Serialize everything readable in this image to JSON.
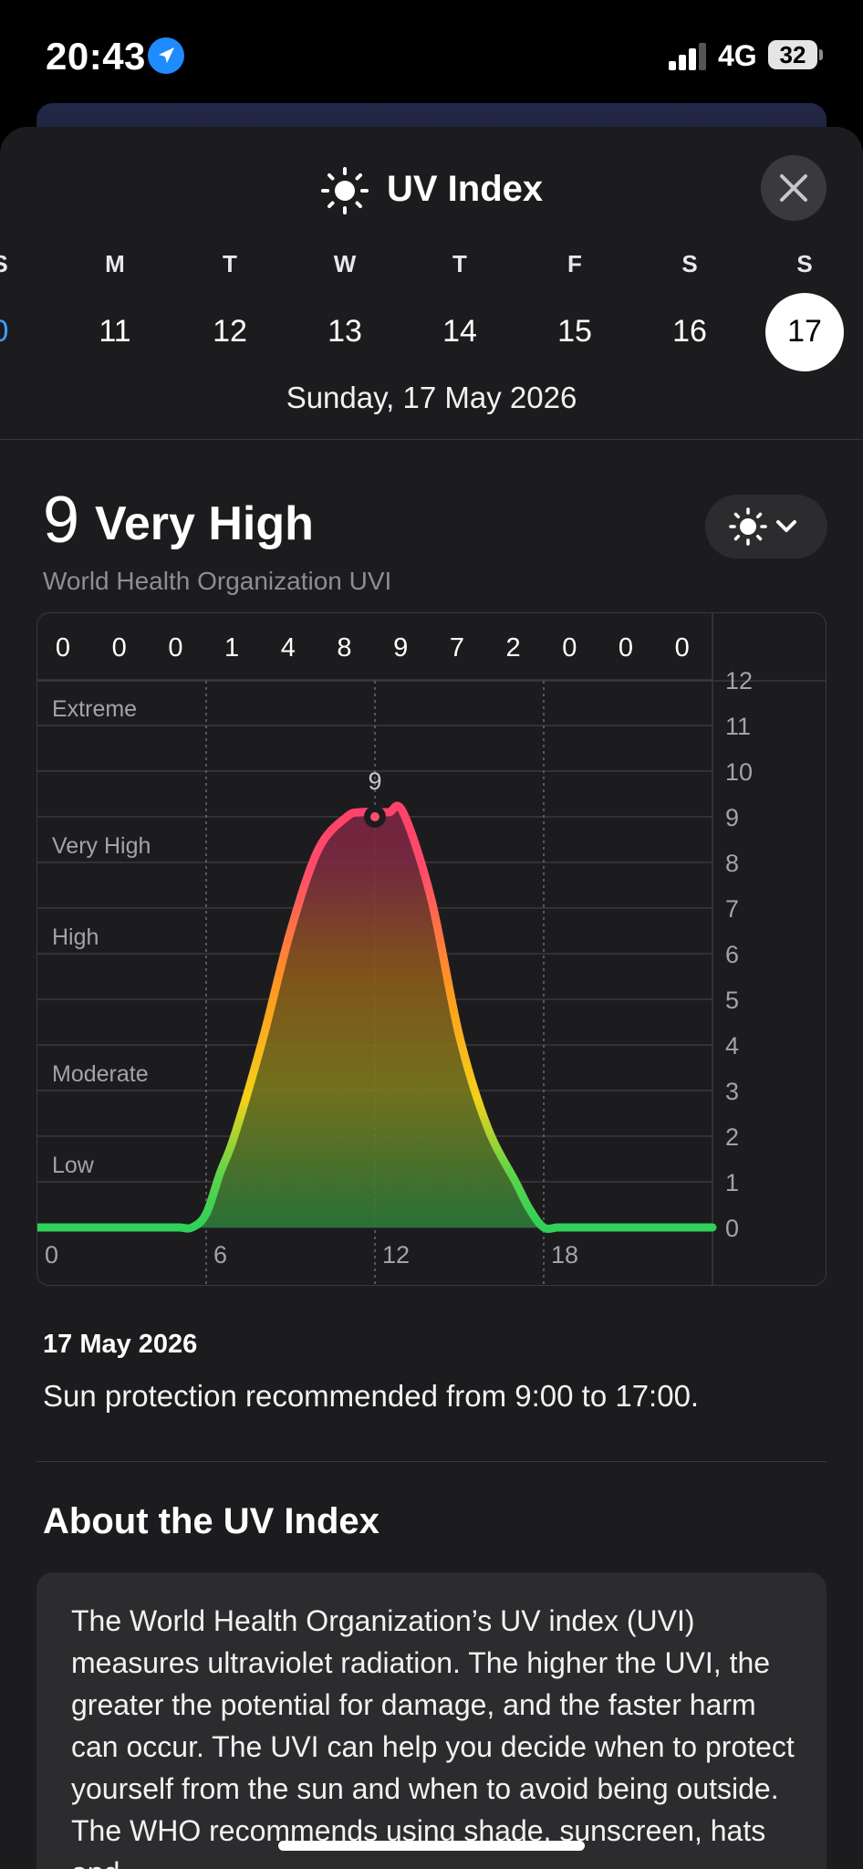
{
  "status_bar": {
    "time": "20:43",
    "network": "4G",
    "battery": "32"
  },
  "title": "UV Index",
  "days": [
    {
      "name": "S",
      "date": "0",
      "state": "edge"
    },
    {
      "name": "M",
      "date": "11"
    },
    {
      "name": "T",
      "date": "12"
    },
    {
      "name": "W",
      "date": "13"
    },
    {
      "name": "T",
      "date": "14"
    },
    {
      "name": "F",
      "date": "15"
    },
    {
      "name": "S",
      "date": "16"
    },
    {
      "name": "S",
      "date": "17",
      "state": "selected"
    }
  ],
  "selected_date": "Sunday, 17 May 2026",
  "uv": {
    "value": "9",
    "category": "Very High",
    "subtitle": "World Health Organization UVI"
  },
  "chart_data": {
    "type": "area",
    "hourly_top_row": [
      "0",
      "0",
      "0",
      "1",
      "4",
      "8",
      "9",
      "7",
      "2",
      "0",
      "0",
      "0"
    ],
    "x": [
      0,
      1,
      2,
      3,
      4,
      5,
      5.5,
      6,
      6.5,
      7,
      8,
      9,
      10,
      11,
      11.5,
      12,
      12.5,
      13,
      14,
      15,
      16,
      17,
      17.5,
      18,
      18.5,
      19,
      24
    ],
    "y": [
      0,
      0,
      0,
      0,
      0,
      0,
      0,
      0.3,
      1.2,
      2.0,
      4.1,
      6.5,
      8.3,
      9.0,
      9.1,
      9.1,
      9.1,
      9.1,
      7.2,
      4.2,
      2.2,
      1.0,
      0.4,
      0,
      0,
      0,
      0
    ],
    "x_ticks": [
      "0",
      "6",
      "12",
      "18"
    ],
    "y_ticks": [
      "0",
      "1",
      "2",
      "3",
      "4",
      "5",
      "6",
      "7",
      "8",
      "9",
      "10",
      "11",
      "12"
    ],
    "ylim": [
      0,
      12
    ],
    "xlim": [
      0,
      24
    ],
    "bands": [
      {
        "label": "Low",
        "y": 1
      },
      {
        "label": "Moderate",
        "y": 3
      },
      {
        "label": "High",
        "y": 6
      },
      {
        "label": "Very High",
        "y": 8
      },
      {
        "label": "Extreme",
        "y": 11
      }
    ],
    "peak": {
      "x": 12,
      "y": 9,
      "label": "9"
    },
    "grid": true
  },
  "protection": {
    "date": "17 May 2026",
    "text": "Sun protection recommended from 9:00 to 17:00."
  },
  "about": {
    "title": "About the UV Index",
    "body": "The World Health Organization’s UV index (UVI) measures ultraviolet radiation. The higher the UVI, the greater the potential for damage, and the faster harm can occur. The UVI can help you decide when to protect yourself from the sun and when to avoid being outside. The WHO recommends using shade, sunscreen, hats and"
  },
  "icons": {
    "location": "location-arrow-icon",
    "sun": "sun-icon",
    "close": "close-icon",
    "chevron": "chevron-down-icon"
  }
}
